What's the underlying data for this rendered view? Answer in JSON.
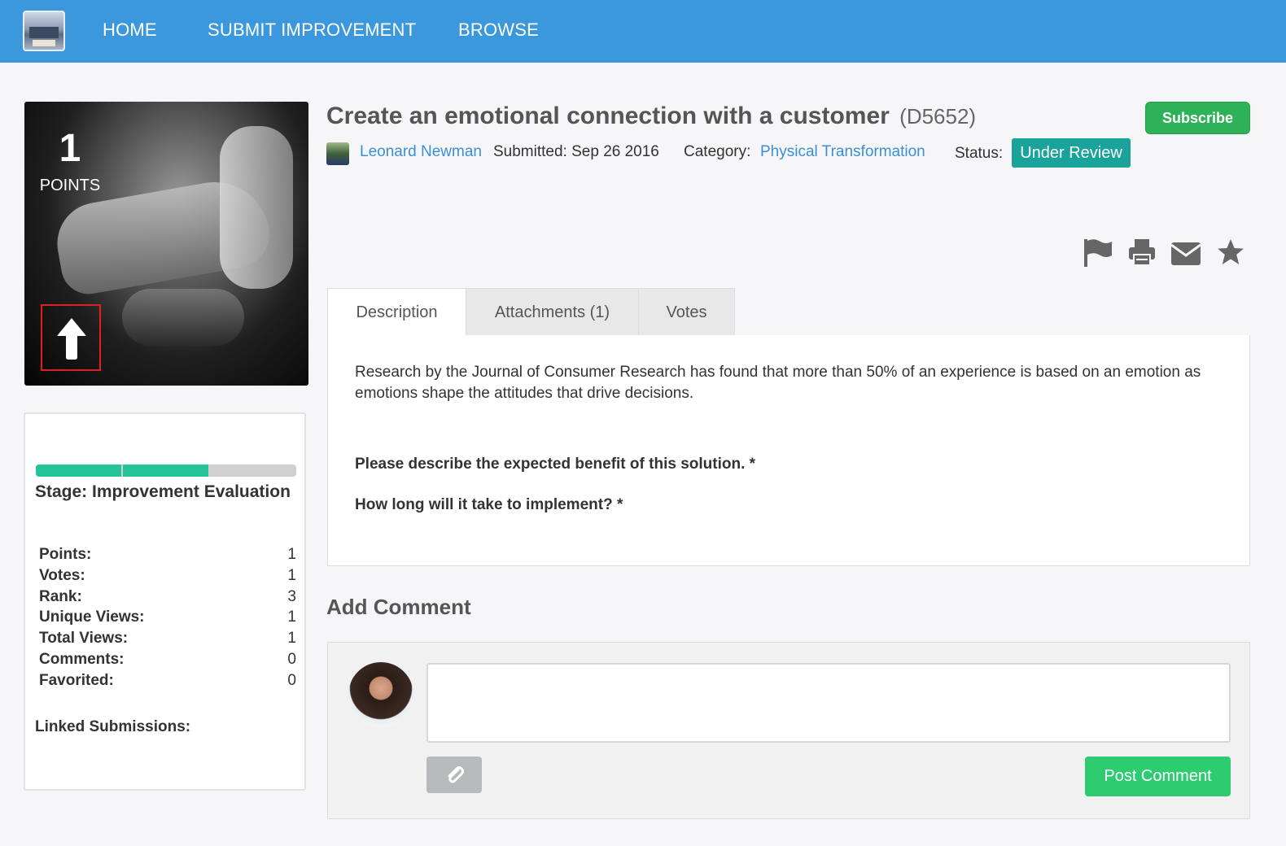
{
  "nav": {
    "logo": "building-logo",
    "items": [
      {
        "label": "HOME"
      },
      {
        "label": "SUBMIT IMPROVEMENT"
      },
      {
        "label": "BROWSE"
      }
    ]
  },
  "card": {
    "points": "1",
    "points_label": "POINTS",
    "vote_icon": "arrow-up-icon"
  },
  "submission": {
    "title": "Create an emotional connection with a customer",
    "code": "(D5652)",
    "subscribe_label": "Subscribe",
    "author": "Leonard Newman",
    "submitted": "Submitted: Sep 26 2016",
    "category_label": "Category:",
    "category": "Physical Transformation",
    "status_label": "Status:",
    "status": "Under Review"
  },
  "actions": [
    {
      "icon": "flag-icon"
    },
    {
      "icon": "print-icon"
    },
    {
      "icon": "envelope-icon"
    },
    {
      "icon": "star-icon"
    }
  ],
  "tabs": [
    {
      "label": "Description"
    },
    {
      "label": "Attachments (1)"
    },
    {
      "label": "Votes"
    }
  ],
  "description": {
    "body": "Research by the Journal of Consumer Research has found that more than 50% of an experience is based on an emotion as emotions shape the attitudes that drive decisions.",
    "q1": "Please describe the expected benefit of this solution. *",
    "q2": "How long will it take to implement? *"
  },
  "stats": {
    "progress_segments_complete": 2,
    "progress_segments_total": 3,
    "stage": "Stage: Improvement Evaluation",
    "rows": [
      {
        "label": "Points:",
        "value": "1"
      },
      {
        "label": "Votes:",
        "value": "1"
      },
      {
        "label": "Rank:",
        "value": "3"
      },
      {
        "label": "Unique Views:",
        "value": "1"
      },
      {
        "label": "Total Views:",
        "value": "1"
      },
      {
        "label": "Comments:",
        "value": "0"
      },
      {
        "label": "Favorited:",
        "value": "0"
      }
    ],
    "linked_label": "Linked Submissions:"
  },
  "comment": {
    "heading": "Add Comment",
    "input_value": "",
    "attach_icon": "paperclip-icon",
    "post_label": "Post Comment"
  },
  "colors": {
    "nav_bg": "#3b98dc",
    "accent_green": "#2db257",
    "status_teal": "#1aa39a",
    "link_blue": "#3b8fd6",
    "progress": "#26c39a"
  }
}
